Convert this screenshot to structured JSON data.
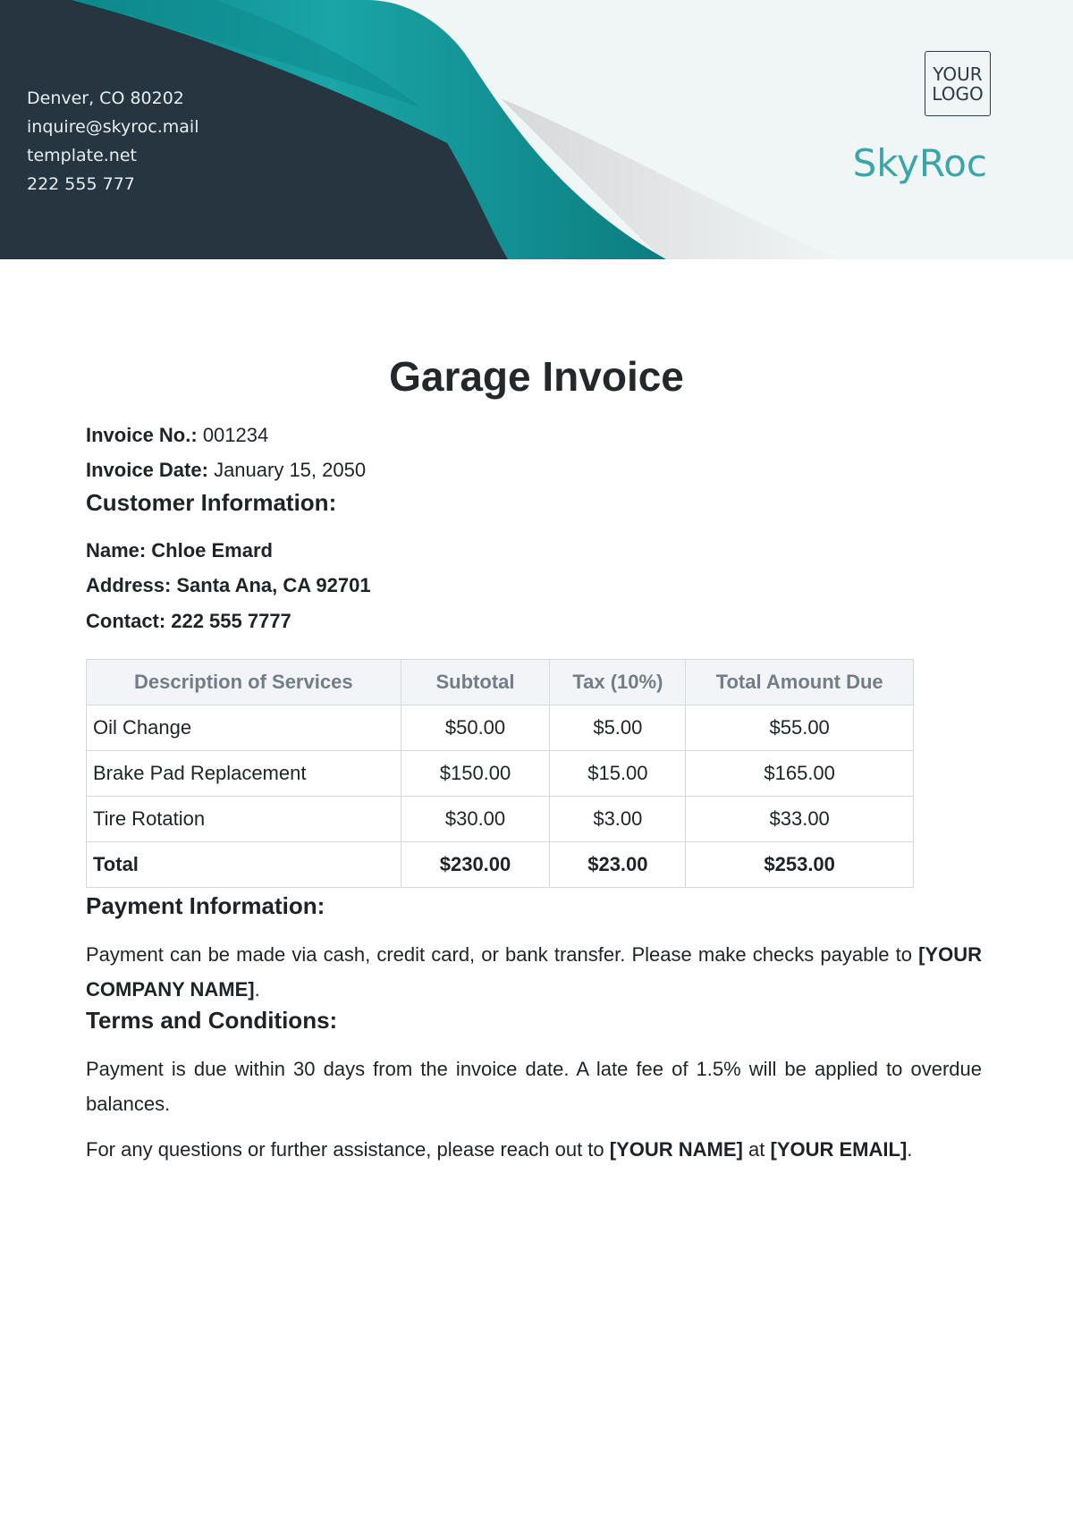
{
  "header": {
    "contact": [
      "Denver, CO 80202",
      "inquire@skyroc.mail",
      "template.net",
      "222 555 777"
    ],
    "logo_line1": "YOUR",
    "logo_line2": "LOGO",
    "brand": "SkyRoc",
    "colors": {
      "dark": "#263540",
      "teal": "#0d8f91",
      "brand_text": "#3aa6ac"
    }
  },
  "title": "Garage Invoice",
  "invoice": {
    "number_label": "Invoice No.:",
    "number": "001234",
    "date_label": "Invoice Date:",
    "date": "January 15, 2050"
  },
  "customer": {
    "heading": "Customer Information:",
    "name_label": "Name:",
    "name": "Chloe Emard",
    "address_label": "Address:",
    "address": "Santa Ana, CA 92701",
    "contact_label": "Contact:",
    "contact": "222 555 7777"
  },
  "table": {
    "headers": [
      "Description of Services",
      "Subtotal",
      "Tax (10%)",
      "Total Amount Due"
    ],
    "rows": [
      [
        "Oil Change",
        "$50.00",
        "$5.00",
        "$55.00"
      ],
      [
        "Brake Pad Replacement",
        "$150.00",
        "$15.00",
        "$165.00"
      ],
      [
        "Tire Rotation",
        "$30.00",
        "$3.00",
        "$33.00"
      ]
    ],
    "total": [
      "Total",
      "$230.00",
      "$23.00",
      "$253.00"
    ]
  },
  "payment": {
    "heading": "Payment Information:",
    "text": "Payment can be made via cash, credit card, or bank transfer. Please make checks payable to",
    "company": "[YOUR COMPANY NAME]",
    "end": "."
  },
  "terms": {
    "heading": "Terms and Conditions:",
    "text": "Payment is due within 30 days from the invoice date. A late fee of 1.5% will be applied to overdue balances.",
    "contact_prefix": "For any questions or further assistance, please reach out to",
    "your_name": "[YOUR NAME]",
    "at": "at",
    "your_email": "[YOUR EMAIL]",
    "end": "."
  }
}
